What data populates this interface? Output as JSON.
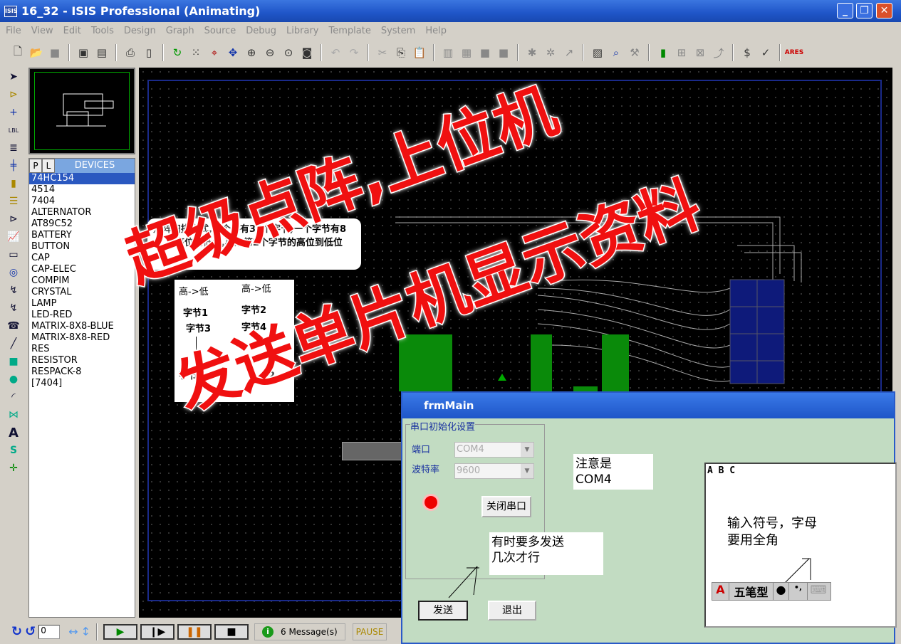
{
  "window": {
    "title": "16_32 - ISIS Professional (Animating)",
    "app_icon": "ISIS"
  },
  "menu": [
    "File",
    "View",
    "Edit",
    "Tools",
    "Design",
    "Graph",
    "Source",
    "Debug",
    "Library",
    "Template",
    "System",
    "Help"
  ],
  "devices": {
    "tab_p": "P",
    "tab_l": "L",
    "title": "DEVICES",
    "items": [
      "74HC154",
      "4514",
      "7404",
      "ALTERNATOR",
      "AT89C52",
      "BATTERY",
      "BUTTON",
      "CAP",
      "CAP-ELEC",
      "COMPIM",
      "CRYSTAL",
      "LAMP",
      "LED-RED",
      "MATRIX-8X8-BLUE",
      "MATRIX-8X8-RED",
      "RES",
      "RESISTOR",
      "RESPACK-8",
      "[7404]"
    ],
    "selected": "74HC154"
  },
  "canvas": {
    "note_scan": "点阵扫描方式,一个字有32个字节,一个字节有8位,由高位到低位,再从第2个字节的高位到低位",
    "hl1": "高->低",
    "hl2": "高->低",
    "b1": "字节1",
    "b2": "字节2",
    "b3": "字节3",
    "b4": "字节4",
    "b3b": "字节3",
    "b2b": "2"
  },
  "bottom": {
    "rotation_value": "0",
    "messages": "6 Message(s)",
    "status": "PAUSE"
  },
  "dialog": {
    "title": "frmMain",
    "group_title": "串口初始化设置",
    "port_label": "端口",
    "port_value": "COM4",
    "baud_label": "波特率",
    "baud_value": "9600",
    "close_port": "关闭串口",
    "send": "发送",
    "exit": "退出",
    "textbox_value": "A B C",
    "note_com": "注意是\nCOM4",
    "note_send": "有时要多发送\n几次才行",
    "note_input": "输入符号，字母\n要用全角",
    "ime": {
      "a": "A",
      "mode": "五笔型",
      "dot": "●",
      "punct": "•,"
    }
  },
  "overlay": {
    "line1": "超级点阵,上位机",
    "line2": "发送单片机显示资料",
    "color": "#f01010"
  }
}
